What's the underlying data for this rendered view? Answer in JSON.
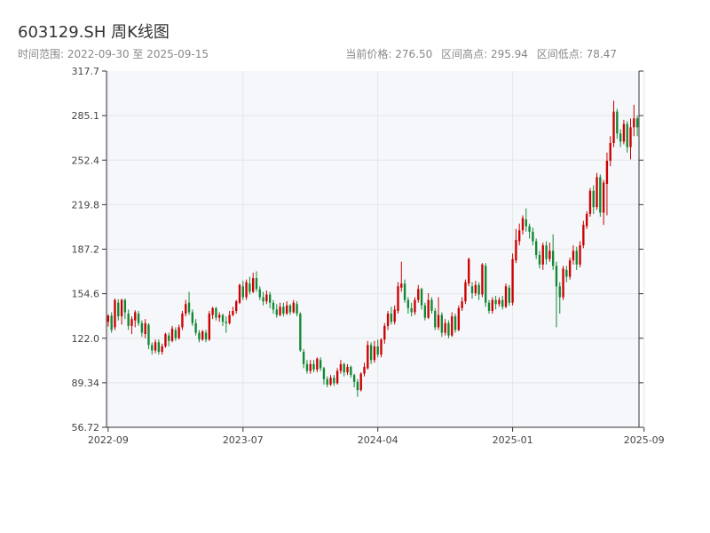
{
  "header": {
    "title": "603129.SH 周K线图",
    "subtitle": "时间范围: 2022-09-30 至 2025-09-15",
    "current_price_label": "当前价格: 276.50",
    "range_high_label": "区间高点: 295.94",
    "range_low_label": "区间低点: 78.47"
  },
  "colors": {
    "up": "#cc0000",
    "down": "#118833",
    "plot_bg": "#f5f7fa",
    "grid": "#e3e6ea",
    "axis": "#333333"
  },
  "chart_data": {
    "type": "candlestick",
    "title": "603129.SH 周K线图",
    "xlabel": "",
    "ylabel": "",
    "ylim": [
      56.72,
      317.7
    ],
    "yticks": [
      "56.72",
      "89.34",
      "122.0",
      "154.6",
      "187.2",
      "219.8",
      "252.4",
      "285.1",
      "317.7"
    ],
    "xticks": [
      {
        "label": "2022-09",
        "index": 0
      },
      {
        "label": "2023-07",
        "index": 40
      },
      {
        "label": "2024-04",
        "index": 80
      },
      {
        "label": "2025-01",
        "index": 120
      },
      {
        "label": "2025-09",
        "index": 159
      }
    ],
    "grid": true,
    "current_price": 276.5,
    "range_high": 295.94,
    "range_low": 78.47,
    "candles": [
      [
        134.0,
        138.5,
        139.5,
        130.5
      ],
      [
        138.5,
        128.0,
        141.0,
        126.0
      ],
      [
        130.0,
        150.0,
        151.0,
        128.0
      ],
      [
        148.0,
        138.0,
        150.5,
        135.0
      ],
      [
        138.0,
        150.0,
        151.0,
        132.0
      ],
      [
        150.0,
        141.0,
        151.0,
        136.0
      ],
      [
        140.0,
        131.0,
        143.0,
        128.0
      ],
      [
        131.0,
        136.0,
        138.0,
        125.0
      ],
      [
        135.0,
        141.0,
        142.5,
        130.0
      ],
      [
        140.0,
        133.0,
        142.0,
        131.0
      ],
      [
        133.0,
        126.0,
        135.0,
        123.0
      ],
      [
        125.0,
        133.0,
        136.0,
        122.0
      ],
      [
        132.0,
        117.0,
        133.0,
        114.0
      ],
      [
        117.0,
        113.0,
        119.0,
        110.0
      ],
      [
        113.0,
        119.0,
        121.0,
        111.0
      ],
      [
        119.0,
        112.0,
        121.0,
        110.0
      ],
      [
        112.0,
        116.0,
        118.0,
        110.0
      ],
      [
        116.0,
        125.0,
        126.0,
        115.0
      ],
      [
        124.0,
        120.0,
        126.0,
        116.0
      ],
      [
        120.0,
        129.0,
        131.0,
        119.0
      ],
      [
        128.0,
        122.0,
        130.0,
        120.0
      ],
      [
        122.0,
        130.0,
        132.0,
        121.0
      ],
      [
        130.0,
        140.0,
        142.0,
        128.0
      ],
      [
        140.0,
        147.0,
        150.0,
        138.0
      ],
      [
        148.0,
        141.0,
        156.0,
        139.0
      ],
      [
        141.0,
        133.0,
        143.0,
        131.0
      ],
      [
        133.0,
        126.0,
        136.0,
        124.0
      ],
      [
        126.0,
        121.0,
        128.0,
        119.0
      ],
      [
        121.0,
        127.0,
        128.0,
        120.0
      ],
      [
        126.0,
        121.0,
        128.0,
        119.0
      ],
      [
        121.0,
        140.0,
        142.0,
        120.0
      ],
      [
        139.0,
        144.0,
        145.0,
        136.0
      ],
      [
        144.0,
        137.0,
        145.0,
        135.0
      ],
      [
        137.0,
        139.0,
        141.0,
        134.0
      ],
      [
        139.0,
        134.0,
        140.0,
        131.0
      ],
      [
        134.0,
        133.0,
        138.0,
        126.0
      ],
      [
        133.0,
        139.0,
        142.0,
        132.0
      ],
      [
        139.0,
        142.0,
        145.0,
        138.0
      ],
      [
        142.0,
        149.0,
        150.0,
        140.0
      ],
      [
        148.0,
        161.0,
        162.0,
        147.0
      ],
      [
        160.0,
        152.0,
        164.0,
        150.0
      ],
      [
        152.0,
        163.0,
        165.0,
        150.0
      ],
      [
        162.0,
        156.0,
        167.0,
        154.0
      ],
      [
        156.0,
        166.0,
        170.0,
        155.0
      ],
      [
        166.0,
        158.0,
        171.0,
        156.0
      ],
      [
        158.0,
        152.0,
        160.0,
        150.0
      ],
      [
        152.0,
        149.0,
        156.0,
        146.0
      ],
      [
        149.0,
        154.0,
        157.0,
        147.0
      ],
      [
        154.0,
        148.0,
        156.0,
        144.0
      ],
      [
        148.0,
        143.0,
        150.0,
        140.0
      ],
      [
        143.0,
        139.0,
        147.0,
        137.0
      ],
      [
        139.0,
        145.0,
        148.0,
        138.0
      ],
      [
        145.0,
        140.0,
        148.0,
        138.0
      ],
      [
        140.0,
        146.0,
        149.0,
        139.0
      ],
      [
        146.0,
        141.0,
        147.0,
        139.0
      ],
      [
        141.0,
        148.0,
        150.0,
        140.0
      ],
      [
        147.0,
        140.0,
        149.0,
        138.0
      ],
      [
        140.0,
        113.0,
        141.0,
        112.0
      ],
      [
        112.0,
        103.0,
        114.0,
        100.0
      ],
      [
        103.0,
        98.0,
        106.0,
        96.0
      ],
      [
        98.0,
        103.0,
        106.0,
        96.0
      ],
      [
        103.0,
        99.0,
        106.0,
        97.0
      ],
      [
        99.0,
        107.0,
        108.0,
        97.0
      ],
      [
        106.0,
        100.0,
        108.0,
        98.0
      ],
      [
        100.0,
        92.0,
        101.0,
        88.0
      ],
      [
        92.0,
        88.0,
        94.0,
        86.0
      ],
      [
        88.0,
        93.0,
        95.0,
        87.0
      ],
      [
        93.0,
        89.0,
        95.0,
        87.0
      ],
      [
        89.0,
        98.0,
        100.0,
        88.0
      ],
      [
        98.0,
        103.0,
        106.0,
        96.0
      ],
      [
        103.0,
        97.0,
        104.0,
        94.0
      ],
      [
        97.0,
        101.0,
        103.0,
        95.0
      ],
      [
        101.0,
        95.0,
        102.0,
        93.0
      ],
      [
        95.0,
        90.0,
        96.0,
        86.0
      ],
      [
        90.0,
        84.0,
        92.0,
        79.0
      ],
      [
        84.0,
        96.0,
        97.0,
        83.0
      ],
      [
        96.0,
        101.0,
        104.0,
        94.0
      ],
      [
        100.0,
        117.0,
        120.0,
        99.0
      ],
      [
        117.0,
        106.0,
        119.0,
        103.0
      ],
      [
        106.0,
        116.0,
        120.0,
        104.0
      ],
      [
        116.0,
        110.0,
        121.0,
        108.0
      ],
      [
        110.0,
        121.0,
        122.0,
        108.0
      ],
      [
        121.0,
        131.0,
        133.0,
        118.0
      ],
      [
        131.0,
        140.0,
        142.0,
        128.0
      ],
      [
        140.0,
        134.0,
        145.0,
        132.0
      ],
      [
        134.0,
        143.0,
        146.0,
        132.0
      ],
      [
        142.0,
        160.0,
        163.0,
        140.0
      ],
      [
        159.0,
        162.0,
        178.0,
        156.0
      ],
      [
        162.0,
        150.0,
        165.0,
        148.0
      ],
      [
        150.0,
        144.0,
        152.0,
        140.0
      ],
      [
        144.0,
        141.0,
        148.0,
        138.0
      ],
      [
        141.0,
        150.0,
        152.0,
        139.0
      ],
      [
        150.0,
        158.0,
        161.0,
        148.0
      ],
      [
        158.0,
        146.0,
        159.0,
        143.0
      ],
      [
        146.0,
        137.0,
        148.0,
        135.0
      ],
      [
        137.0,
        150.0,
        155.0,
        136.0
      ],
      [
        150.0,
        142.0,
        152.0,
        140.0
      ],
      [
        142.0,
        130.0,
        144.0,
        128.0
      ],
      [
        130.0,
        139.0,
        152.0,
        128.0
      ],
      [
        139.0,
        126.0,
        141.0,
        123.0
      ],
      [
        126.0,
        133.0,
        136.0,
        124.0
      ],
      [
        133.0,
        124.0,
        135.0,
        122.0
      ],
      [
        124.0,
        138.0,
        141.0,
        123.0
      ],
      [
        138.0,
        128.0,
        140.0,
        126.0
      ],
      [
        128.0,
        144.0,
        146.0,
        127.0
      ],
      [
        144.0,
        149.0,
        152.0,
        142.0
      ],
      [
        149.0,
        163.0,
        165.0,
        147.0
      ],
      [
        162.0,
        180.0,
        181.0,
        160.0
      ],
      [
        160.0,
        155.0,
        163.0,
        151.0
      ],
      [
        155.0,
        161.0,
        164.0,
        153.0
      ],
      [
        161.0,
        154.0,
        163.0,
        150.0
      ],
      [
        154.0,
        176.0,
        177.0,
        152.0
      ],
      [
        175.0,
        148.0,
        177.0,
        145.0
      ],
      [
        148.0,
        142.0,
        150.0,
        140.0
      ],
      [
        142.0,
        150.0,
        152.0,
        140.0
      ],
      [
        150.0,
        147.0,
        153.0,
        143.0
      ],
      [
        147.0,
        150.0,
        152.0,
        145.0
      ],
      [
        150.0,
        145.0,
        153.0,
        143.0
      ],
      [
        145.0,
        160.0,
        162.0,
        144.0
      ],
      [
        159.0,
        148.0,
        161.0,
        146.0
      ],
      [
        148.0,
        180.0,
        184.0,
        146.0
      ],
      [
        179.0,
        194.0,
        202.0,
        177.0
      ],
      [
        193.0,
        201.0,
        206.0,
        190.0
      ],
      [
        201.0,
        210.0,
        212.0,
        198.0
      ],
      [
        209.0,
        204.0,
        217.0,
        200.0
      ],
      [
        204.0,
        200.0,
        206.0,
        195.0
      ],
      [
        200.0,
        193.0,
        203.0,
        190.0
      ],
      [
        193.0,
        183.0,
        195.0,
        180.0
      ],
      [
        183.0,
        176.0,
        186.0,
        173.0
      ],
      [
        176.0,
        190.0,
        192.0,
        172.0
      ],
      [
        190.0,
        180.0,
        193.0,
        176.0
      ],
      [
        180.0,
        186.0,
        192.0,
        178.0
      ],
      [
        186.0,
        175.0,
        198.0,
        172.0
      ],
      [
        175.0,
        160.0,
        178.0,
        130.0
      ],
      [
        160.0,
        152.0,
        163.0,
        140.0
      ],
      [
        152.0,
        173.0,
        175.0,
        150.0
      ],
      [
        172.0,
        167.0,
        175.0,
        163.0
      ],
      [
        167.0,
        179.0,
        181.0,
        165.0
      ],
      [
        179.0,
        186.0,
        190.0,
        176.0
      ],
      [
        186.0,
        176.0,
        189.0,
        172.0
      ],
      [
        176.0,
        190.0,
        193.0,
        174.0
      ],
      [
        190.0,
        205.0,
        208.0,
        188.0
      ],
      [
        204.0,
        213.0,
        215.0,
        202.0
      ],
      [
        213.0,
        230.0,
        232.0,
        211.0
      ],
      [
        230.0,
        218.0,
        234.0,
        213.0
      ],
      [
        218.0,
        240.0,
        243.0,
        216.0
      ],
      [
        240.0,
        214.0,
        242.0,
        211.0
      ],
      [
        214.0,
        236.0,
        238.0,
        205.0
      ],
      [
        235.0,
        252.0,
        258.0,
        212.0
      ],
      [
        252.0,
        265.0,
        270.0,
        248.0
      ],
      [
        265.0,
        288.0,
        296.0,
        262.0
      ],
      [
        288.0,
        272.0,
        290.0,
        268.0
      ],
      [
        272.0,
        266.0,
        275.0,
        262.0
      ],
      [
        266.0,
        279.0,
        282.0,
        264.0
      ],
      [
        279.0,
        262.0,
        281.0,
        258.0
      ],
      [
        262.0,
        276.5,
        283.0,
        253.0
      ],
      [
        276.5,
        283.0,
        293.0,
        270.0
      ],
      [
        283.0,
        276.5,
        285.0,
        270.0
      ]
    ]
  }
}
